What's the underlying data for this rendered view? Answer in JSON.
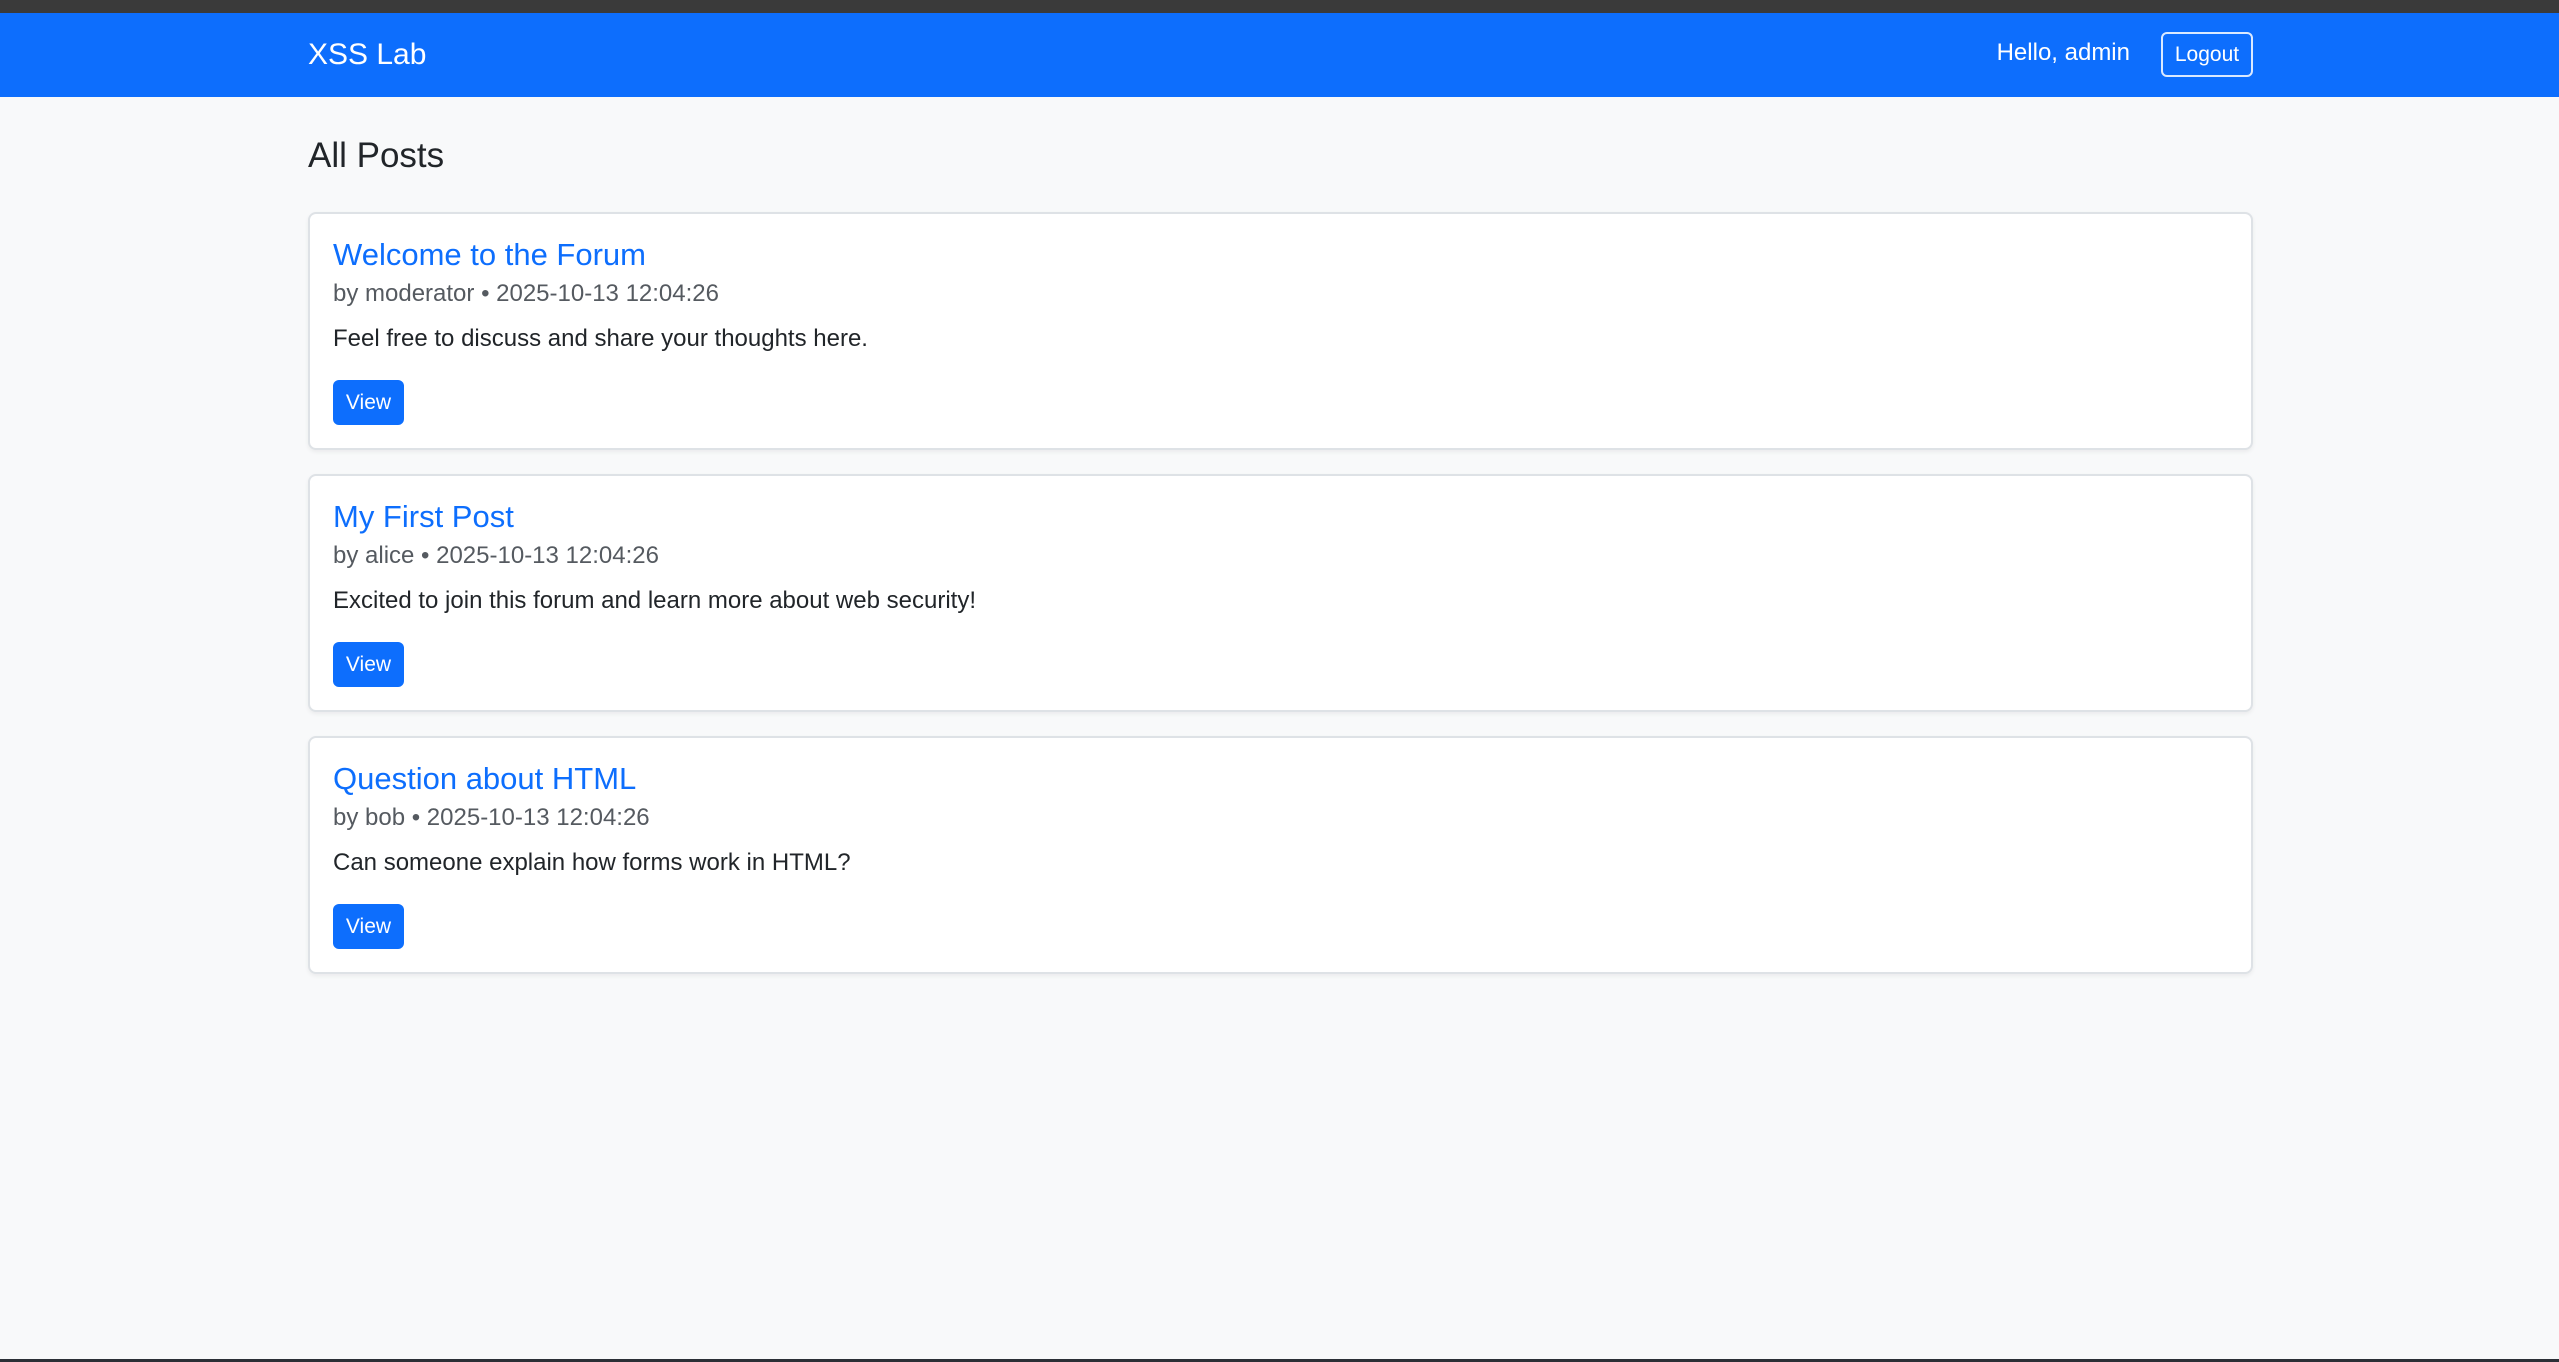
{
  "navbar": {
    "brand": "XSS Lab",
    "greeting": "Hello, admin",
    "logout_label": "Logout"
  },
  "main": {
    "title": "All Posts",
    "view_label": "View",
    "posts": [
      {
        "title": "Welcome to the Forum",
        "meta": "by moderator • 2025-10-13 12:04:26",
        "excerpt": "Feel free to discuss and share your thoughts here."
      },
      {
        "title": "My First Post",
        "meta": "by alice • 2025-10-13 12:04:26",
        "excerpt": "Excited to join this forum and learn more about web security!"
      },
      {
        "title": "Question about HTML",
        "meta": "by bob • 2025-10-13 12:04:26",
        "excerpt": "Can someone explain how forms work in HTML?"
      }
    ]
  },
  "colors": {
    "primary": "#0d6efd",
    "background": "#f8f9fa",
    "card_border": "#dee2e6"
  }
}
